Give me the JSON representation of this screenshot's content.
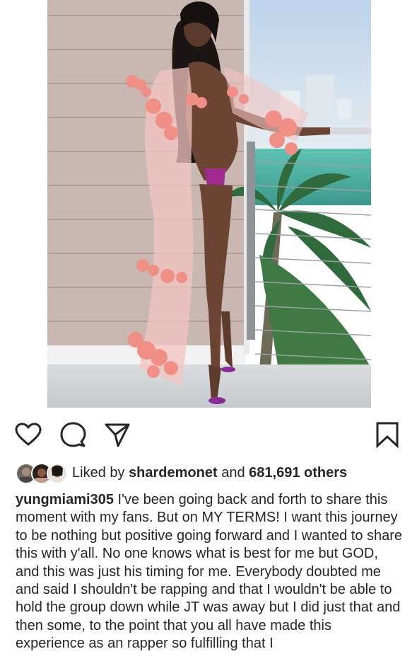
{
  "post": {
    "image_alt": "Photo on balcony overlooking water and palm trees"
  },
  "actions": {
    "like_icon": "heart-outline-icon",
    "comment_icon": "comment-bubble-icon",
    "share_icon": "paper-plane-icon",
    "save_icon": "bookmark-icon"
  },
  "likes": {
    "prefix": "Liked by ",
    "user": "shardemonet",
    "middle": " and ",
    "count": "681,691 others"
  },
  "caption": {
    "username": "yungmiami305",
    "text": " I've been going back and forth to share this moment with my fans. But on MY TERMS! I want this journey to be nothing but positive going forward and I wanted to share this with y'all. No one knows what is best for me but GOD, and this was just his timing for me. Everybody doubted me and said I shouldn't be rapping and that I wouldn't be able to hold the group down while JT was away but I did just that and then some, to the point that you all have made this experience as an rapper so fulfilling that I"
  },
  "colors": {
    "text": "#262626",
    "icon": "#262626"
  }
}
